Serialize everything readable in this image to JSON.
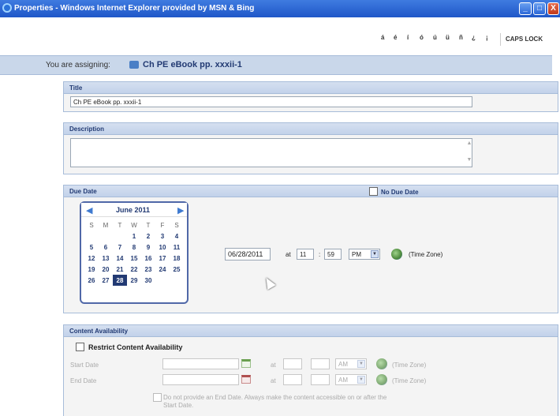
{
  "window": {
    "title": "Properties - Windows Internet Explorer provided by MSN & Bing",
    "minimize": "_",
    "maximize": "□",
    "close": "X"
  },
  "charbar": {
    "chars": [
      "á",
      "é",
      "í",
      "ó",
      "ú",
      "ü",
      "ñ",
      "¿",
      "¡"
    ],
    "caps_lock": "CAPS LOCK"
  },
  "assign": {
    "label": "You are assigning:",
    "item": "Ch PE eBook pp. xxxii-1"
  },
  "title_section": {
    "heading": "Title",
    "value": "Ch PE eBook pp. xxxii-1"
  },
  "description_section": {
    "heading": "Description",
    "value": ""
  },
  "due_date": {
    "heading": "Due Date",
    "no_due_date_label": "No Due Date",
    "calendar": {
      "month": "June 2011",
      "dow": [
        "S",
        "M",
        "T",
        "W",
        "T",
        "F",
        "S"
      ],
      "weeks": [
        [
          "",
          "",
          "",
          "1",
          "2",
          "3",
          "4"
        ],
        [
          "5",
          "6",
          "7",
          "8",
          "9",
          "10",
          "11"
        ],
        [
          "12",
          "13",
          "14",
          "15",
          "16",
          "17",
          "18"
        ],
        [
          "19",
          "20",
          "21",
          "22",
          "23",
          "24",
          "25"
        ],
        [
          "26",
          "27",
          "28",
          "29",
          "30",
          "",
          ""
        ]
      ],
      "selected": "28"
    },
    "date": "06/28/2011",
    "at": "at",
    "hour": "11",
    "sep": ":",
    "minute": "59",
    "ampm": "PM",
    "time_zone": "(Time Zone)"
  },
  "content_availability": {
    "heading": "Content Availability",
    "restrict_label": "Restrict Content Availability",
    "start_label": "Start Date",
    "end_label": "End Date",
    "at": "at",
    "ampm": "AM",
    "time_zone": "(Time Zone)",
    "no_end_date_label": "Do not provide an End Date. Always make the content accessible on or after the Start Date."
  },
  "colors": {
    "accent": "#223a73",
    "header_bg": "#c9d7ea",
    "selected_day": "#223a73"
  }
}
